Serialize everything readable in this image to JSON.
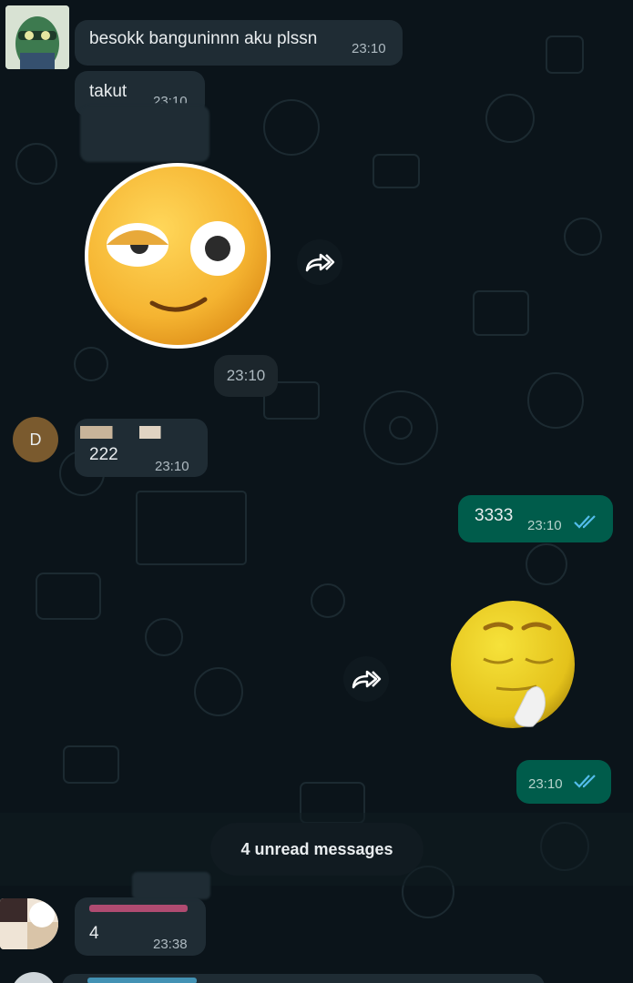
{
  "colors": {
    "incoming_bubble": "#1f2c34",
    "outgoing_bubble": "#005c4b",
    "read_ticks": "#53bdeb",
    "avatar_d": "#7a5a2e",
    "sender_name_pink": "#e25585",
    "sender_name_blue": "#53bdeb"
  },
  "messages": [
    {
      "text": "besokk banguninnn aku plssn",
      "time": "23:10"
    },
    {
      "text": "takut",
      "time": "23:10"
    },
    {
      "sticker": "flushed-face-sticker",
      "time": "23:10"
    },
    {
      "avatar_letter": "D",
      "text": "222",
      "time": "23:10"
    },
    {
      "text": "3333",
      "time": "23:10"
    },
    {
      "sticker": "praying-face-sticker",
      "time": "23:10"
    },
    {
      "text": "4",
      "time": "23:38"
    }
  ],
  "unread": {
    "label": "4 unread messages"
  },
  "icons": {
    "forward": "forward-icon",
    "ticks": "double-check-icon"
  }
}
